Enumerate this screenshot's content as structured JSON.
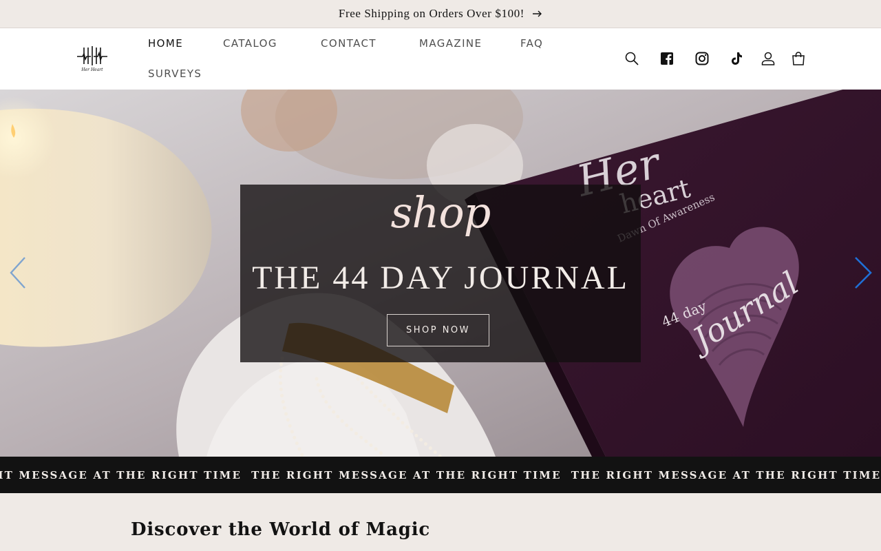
{
  "announcement": {
    "text": "Free Shipping on Orders Over $100!",
    "icon": "arrow-right-icon"
  },
  "header": {
    "logo_alt": "Her Heart",
    "nav": [
      {
        "label": "HOME",
        "active": true
      },
      {
        "label": "CATALOG",
        "active": false
      },
      {
        "label": "CONTACT",
        "active": false
      },
      {
        "label": "MAGAZINE",
        "active": false
      },
      {
        "label": "FAQ",
        "active": false
      },
      {
        "label": "SURVEYS",
        "active": false
      }
    ],
    "icons": [
      "search-icon",
      "facebook-icon",
      "instagram-icon",
      "tiktok-icon",
      "account-icon",
      "cart-icon"
    ]
  },
  "hero": {
    "script_text": "shop",
    "title": "THE 44 DAY JOURNAL",
    "button_label": "SHOP NOW",
    "journal_cover": {
      "title_script": "Her",
      "title_word": "heart",
      "subtitle": "Dawn Of Awareness",
      "label_small": "44 day",
      "label_script": "Journal"
    },
    "colors": {
      "overlay": "#120e10",
      "accent_arrow": "#1f6fd6"
    }
  },
  "marquee": {
    "items": [
      "IGHT MESSAGE AT THE RIGHT TIME",
      "THE RIGHT MESSAGE AT THE RIGHT TIME",
      "THE RIGHT MESSAGE AT THE RIGHT TIME"
    ]
  },
  "section": {
    "title": "Discover the World of Magic"
  }
}
